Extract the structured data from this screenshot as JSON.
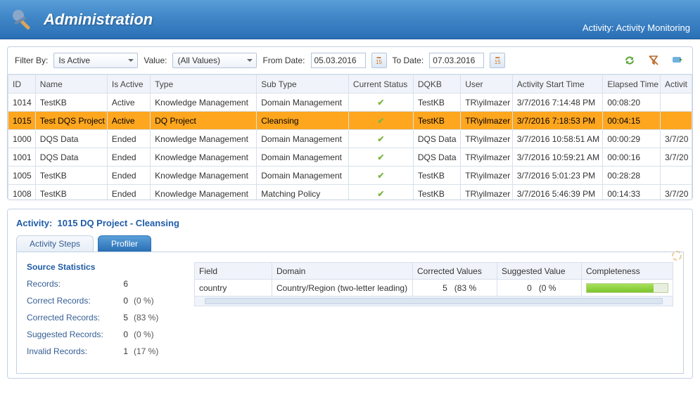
{
  "header": {
    "title": "Administration",
    "activity": "Activity: Activity Monitoring"
  },
  "filters": {
    "filterByLabel": "Filter By:",
    "filterByValue": "Is Active",
    "valueLabel": "Value:",
    "valueValue": "(All Values)",
    "fromLabel": "From Date:",
    "fromValue": "05.03.2016",
    "toLabel": "To Date:",
    "toValue": "07.03.2016",
    "calText": "15"
  },
  "gridColumns": [
    "ID",
    "Name",
    "Is Active",
    "Type",
    "Sub Type",
    "Current Status",
    "DQKB",
    "User",
    "Activity Start Time",
    "Elapsed Time",
    "Activit"
  ],
  "gridColWidths": [
    38,
    100,
    60,
    148,
    128,
    90,
    66,
    72,
    126,
    80,
    44
  ],
  "rows": [
    {
      "id": "1014",
      "name": "TestKB",
      "active": "Active",
      "type": "Knowledge Management",
      "sub": "Domain Management",
      "status": "check",
      "dqkb": "TestKB",
      "user": "TR\\yilmazer",
      "start": "3/7/2016 7:14:48 PM",
      "elapsed": "00:08:20",
      "end": ""
    },
    {
      "id": "1015",
      "name": "Test DQS Project",
      "active": "Active",
      "type": "DQ Project",
      "sub": "Cleansing",
      "status": "check",
      "dqkb": "TestKB",
      "user": "TR\\yilmazer",
      "start": "3/7/2016 7:18:53 PM",
      "elapsed": "00:04:15",
      "end": "",
      "selected": true
    },
    {
      "id": "1000",
      "name": "DQS Data",
      "active": "Ended",
      "type": "Knowledge Management",
      "sub": "Domain Management",
      "status": "check",
      "dqkb": "DQS Data",
      "user": "TR\\yilmazer",
      "start": "3/7/2016 10:58:51 AM",
      "elapsed": "00:00:29",
      "end": "3/7/20"
    },
    {
      "id": "1001",
      "name": "DQS Data",
      "active": "Ended",
      "type": "Knowledge Management",
      "sub": "Domain Management",
      "status": "check",
      "dqkb": "DQS Data",
      "user": "TR\\yilmazer",
      "start": "3/7/2016 10:59:21 AM",
      "elapsed": "00:00:16",
      "end": "3/7/20"
    },
    {
      "id": "1005",
      "name": "TestKB",
      "active": "Ended",
      "type": "Knowledge Management",
      "sub": "Domain Management",
      "status": "check",
      "dqkb": "TestKB",
      "user": "TR\\yilmazer",
      "start": "3/7/2016 5:01:23 PM",
      "elapsed": "00:28:28",
      "end": ""
    },
    {
      "id": "1008",
      "name": "TestKB",
      "active": "Ended",
      "type": "Knowledge Management",
      "sub": "Matching Policy",
      "status": "check",
      "dqkb": "TestKB",
      "user": "TR\\yilmazer",
      "start": "3/7/2016 5:46:39 PM",
      "elapsed": "00:14:33",
      "end": "3/7/20"
    }
  ],
  "detail": {
    "titlePrefix": "Activity:",
    "titleMain": "1015 DQ Project - Cleansing",
    "tabs": {
      "steps": "Activity Steps",
      "profiler": "Profiler"
    },
    "stats": {
      "heading": "Source Statistics",
      "rows": [
        {
          "label": "Records:",
          "val": "6",
          "pct": ""
        },
        {
          "label": "Correct Records:",
          "val": "0",
          "pct": "(0 %)"
        },
        {
          "label": "Corrected Records:",
          "val": "5",
          "pct": "(83 %)"
        },
        {
          "label": "Suggested Records:",
          "val": "0",
          "pct": "(0 %)"
        },
        {
          "label": "Invalid Records:",
          "val": "1",
          "pct": "(17 %)"
        }
      ]
    },
    "profileCols": [
      "Field",
      "Domain",
      "Corrected Values",
      "Suggested Value",
      "Completeness"
    ],
    "profileColWidths": [
      110,
      200,
      120,
      120,
      130
    ],
    "profileRow": {
      "field": "country",
      "domain": "Country/Region (two-letter leading)",
      "cv_n": "5",
      "cv_p": "(83 %",
      "sv_n": "0",
      "sv_p": "(0 %",
      "completeness": 83
    }
  }
}
